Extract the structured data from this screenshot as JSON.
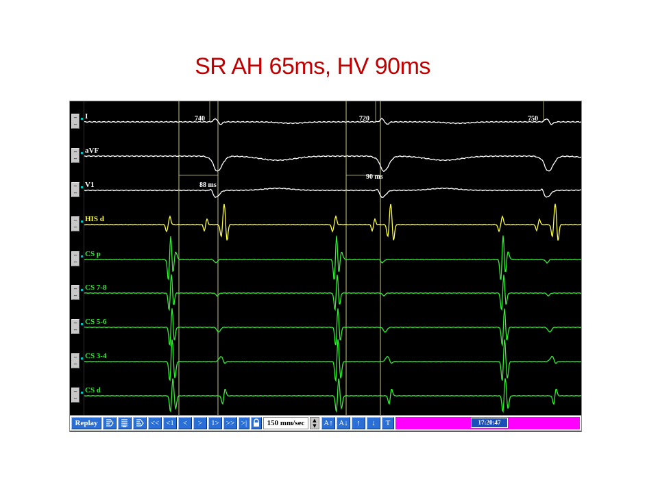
{
  "title": "SR AH 65ms, HV 90ms",
  "colors": {
    "title": "#c00000",
    "surface_ecg": "#ffffff",
    "his": "#ffff44",
    "cs": "#33ee33",
    "caliper": "#c8c88a",
    "toolbar_button": "#2a6fd6",
    "toolbar_magenta": "#ff00ff"
  },
  "channels": [
    {
      "label": "I",
      "color_key": "surface_ecg"
    },
    {
      "label": "aVF",
      "color_key": "surface_ecg"
    },
    {
      "label": "V1",
      "color_key": "surface_ecg"
    },
    {
      "label": "HIS d",
      "color_key": "his"
    },
    {
      "label": "CS p",
      "color_key": "cs"
    },
    {
      "label": "CS 7-8",
      "color_key": "cs"
    },
    {
      "label": "CS 5-6",
      "color_key": "cs"
    },
    {
      "label": "CS 3-4",
      "color_key": "cs"
    },
    {
      "label": "CS d",
      "color_key": "cs"
    }
  ],
  "cycle_lengths": [
    "740",
    "720",
    "750"
  ],
  "interval_measurements": [
    "88 ms",
    "90 ms"
  ],
  "toolbar": {
    "replay": "Replay",
    "icons": [
      "replay-mode-1-icon",
      "replay-mode-2-icon",
      "replay-mode-3-icon"
    ],
    "nav_buttons": [
      "<<",
      "<1",
      "<",
      ">",
      "1>",
      ">>",
      ">|"
    ],
    "lock_icon": "lock-icon",
    "speed": "150 mm/sec",
    "gain_up": "A↑",
    "gain_down": "A↓",
    "arrow_up": "↑",
    "arrow_down": "↓",
    "t_label": "T",
    "time": "17:20:47"
  }
}
